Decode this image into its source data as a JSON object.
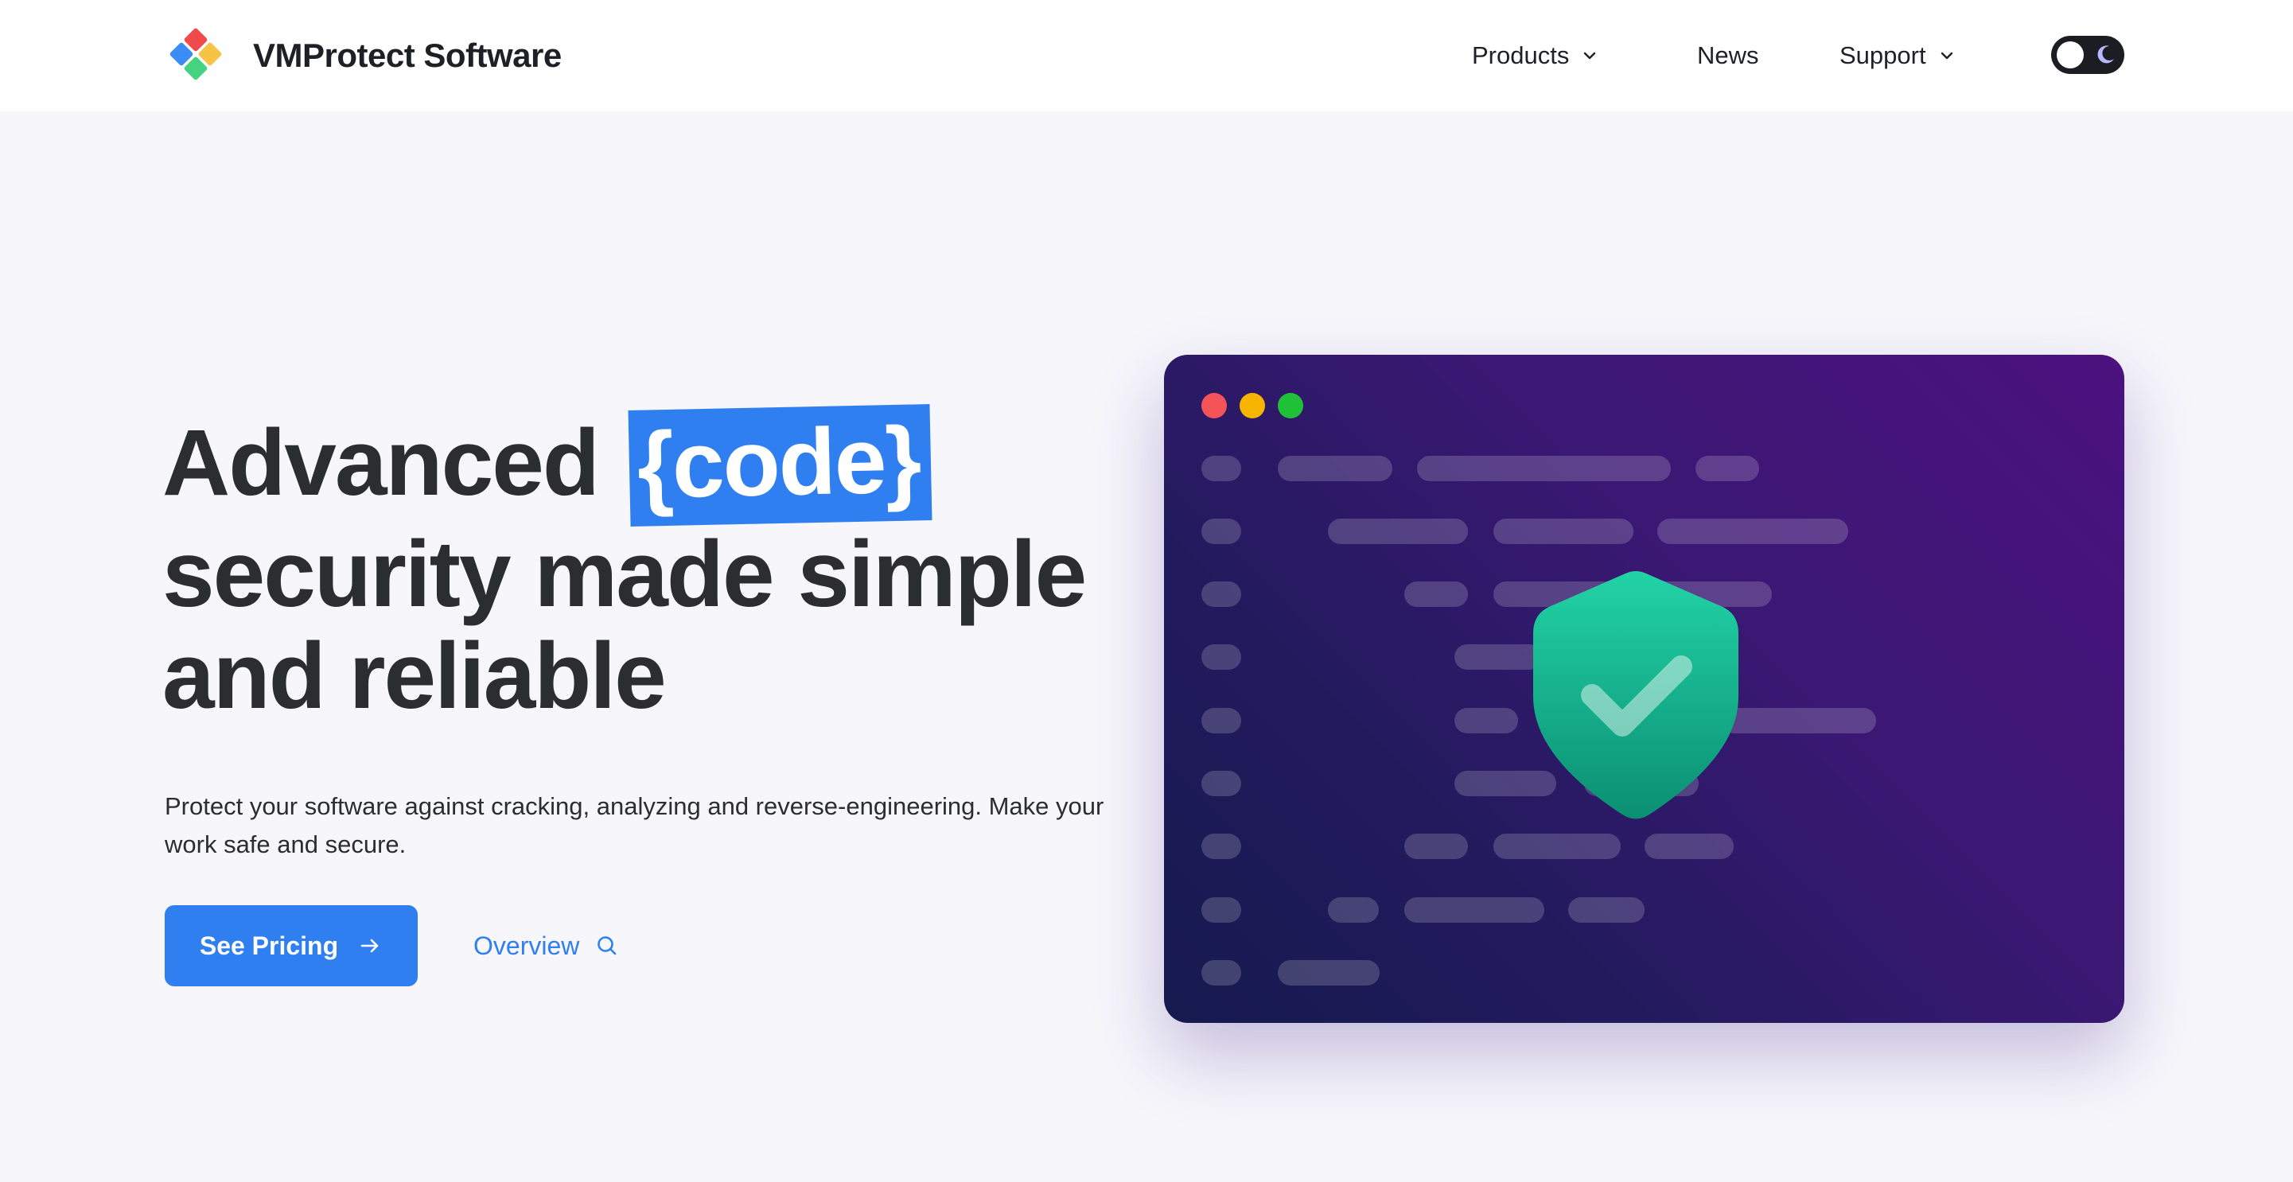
{
  "header": {
    "brand_name": "VMProtect Software",
    "logo_colors": [
      "#f04a4a",
      "#3b8df5",
      "#f6c344",
      "#46d37f"
    ],
    "nav": {
      "products": "Products",
      "news": "News",
      "support": "Support"
    },
    "theme_toggle_icon": "moon-icon"
  },
  "hero": {
    "title_prefix": "Advanced",
    "title_highlight": "{code}",
    "title_line2": "security made simple",
    "title_line3": "and reliable",
    "subtitle": "Protect your software against cracking, analyzing and reverse-engineering. Make your work safe and secure.",
    "primary_button": "See Pricing",
    "secondary_link": "Overview"
  },
  "colors": {
    "accent": "#2f7ff0",
    "text": "#2b2d31",
    "background": "#f6f6fb",
    "shield": "#1fcf9f"
  }
}
